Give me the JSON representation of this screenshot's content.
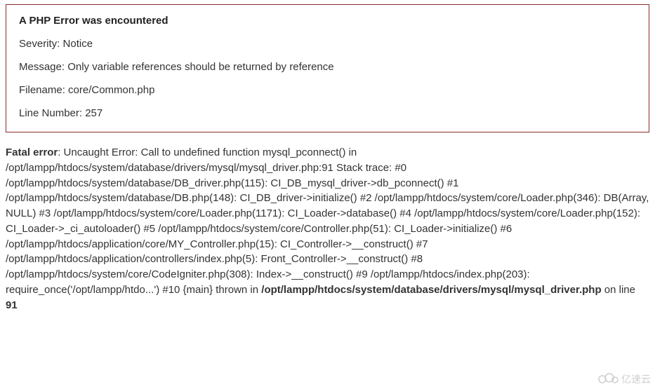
{
  "php_error_box": {
    "title": "A PHP Error was encountered",
    "severity_label": "Severity:",
    "severity_value": "Notice",
    "message_label": "Message:",
    "message_value": "Only variable references should be returned by reference",
    "filename_label": "Filename:",
    "filename_value": "core/Common.php",
    "linenumber_label": "Line Number:",
    "linenumber_value": "257"
  },
  "fatal_error": {
    "prefix_bold": "Fatal error",
    "body_1": ": Uncaught Error: Call to undefined function mysql_pconnect() in /opt/lampp/htdocs/system/database/drivers/mysql/mysql_driver.php:91 Stack trace: #0 /opt/lampp/htdocs/system/database/DB_driver.php(115): CI_DB_mysql_driver->db_pconnect() #1 /opt/lampp/htdocs/system/database/DB.php(148): CI_DB_driver->initialize() #2 /opt/lampp/htdocs/system/core/Loader.php(346): DB(Array, NULL) #3 /opt/lampp/htdocs/system/core/Loader.php(1171): CI_Loader->database() #4 /opt/lampp/htdocs/system/core/Loader.php(152): CI_Loader->_ci_autoloader() #5 /opt/lampp/htdocs/system/core/Controller.php(51): CI_Loader->initialize() #6 /opt/lampp/htdocs/application/core/MY_Controller.php(15): CI_Controller->__construct() #7 /opt/lampp/htdocs/application/controllers/index.php(5): Front_Controller->__construct() #8 /opt/lampp/htdocs/system/core/CodeIgniter.php(308): Index->__construct() #9 /opt/lampp/htdocs/index.php(203): require_once('/opt/lampp/htdo...') #10 {main} thrown in ",
    "path_bold": "/opt/lampp/htdocs/system/database/drivers/mysql/mysql_driver.php",
    "on_line": " on line ",
    "line_bold": "91"
  },
  "watermark": {
    "text": "亿速云"
  }
}
